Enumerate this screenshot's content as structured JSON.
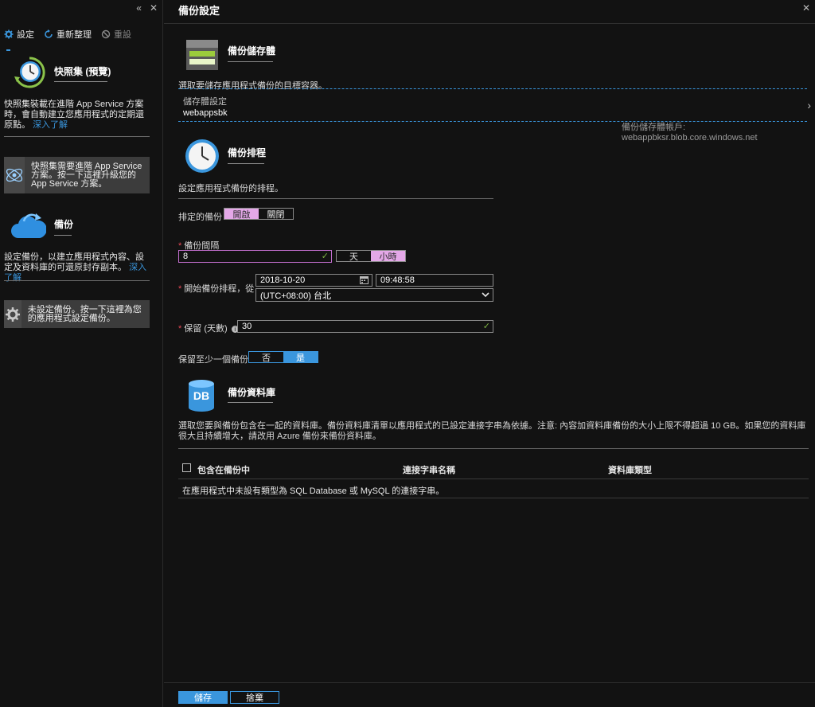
{
  "left_panel": {
    "toolbar": {
      "settings_label": "設定",
      "refresh_label": "重新整理",
      "reset_label": "重設"
    },
    "snapshots": {
      "title": "快照集 (預覽)",
      "description": "快照集裝載在進階 App Service 方案時，會自動建立您應用程式的定期還原點。",
      "link": "深入了解",
      "card_text": "快照集需要進階 App Service 方案。按一下這裡升級您的 App Service 方案。"
    },
    "backup": {
      "title": "備份",
      "description": "設定備份，以建立應用程式內容、設定及資料庫的可還原封存副本。",
      "link": "深入了解",
      "card_text": "未設定備份。按一下這裡為您的應用程式設定備份。"
    }
  },
  "main": {
    "title": "備份設定",
    "storage": {
      "title": "備份儲存體",
      "description": "選取要儲存應用程式備份的目標容器。",
      "settings_label": "儲存體設定",
      "settings_value": "webappsbk",
      "account_text": "備份儲存體帳戶: webappbksr.blob.core.windows.net"
    },
    "schedule": {
      "title": "備份排程",
      "description": "設定應用程式備份的排程。",
      "scheduled_label": "排定的備份",
      "on_label": "開啟",
      "off_label": "關閉",
      "interval_label": "備份間隔",
      "interval_value": "8",
      "day_label": "天",
      "hour_label": "小時",
      "start_label": "開始備份排程，從",
      "start_date": "2018-10-20",
      "start_time": "09:48:58",
      "timezone": "(UTC+08:00) 台北",
      "retention_label": "保留 (天數)",
      "retention_value": "30",
      "keep_label": "保留至少一個備份",
      "no_label": "否",
      "yes_label": "是"
    },
    "database": {
      "title": "備份資料庫",
      "db_icon_text": "DB",
      "description": "選取您要與備份包含在一起的資料庫。備份資料庫清單以應用程式的已設定連接字串為依據。注意: 內容加資料庫備份的大小上限不得超過 10 GB。如果您的資料庫很大且持續增大，請改用 Azure 備份來備份資料庫。",
      "col_include": "包含在備份中",
      "col_conn": "連接字串名稱",
      "col_type": "資料庫類型",
      "empty_message": "在應用程式中未設有類型為 SQL Database 或 MySQL 的連接字串。"
    },
    "save_label": "儲存",
    "discard_label": "捨棄"
  },
  "colors": {
    "accent": "#3a96dd",
    "toggle_selected": "#e4a8e8",
    "required": "#e74856",
    "valid": "#7cb342"
  }
}
